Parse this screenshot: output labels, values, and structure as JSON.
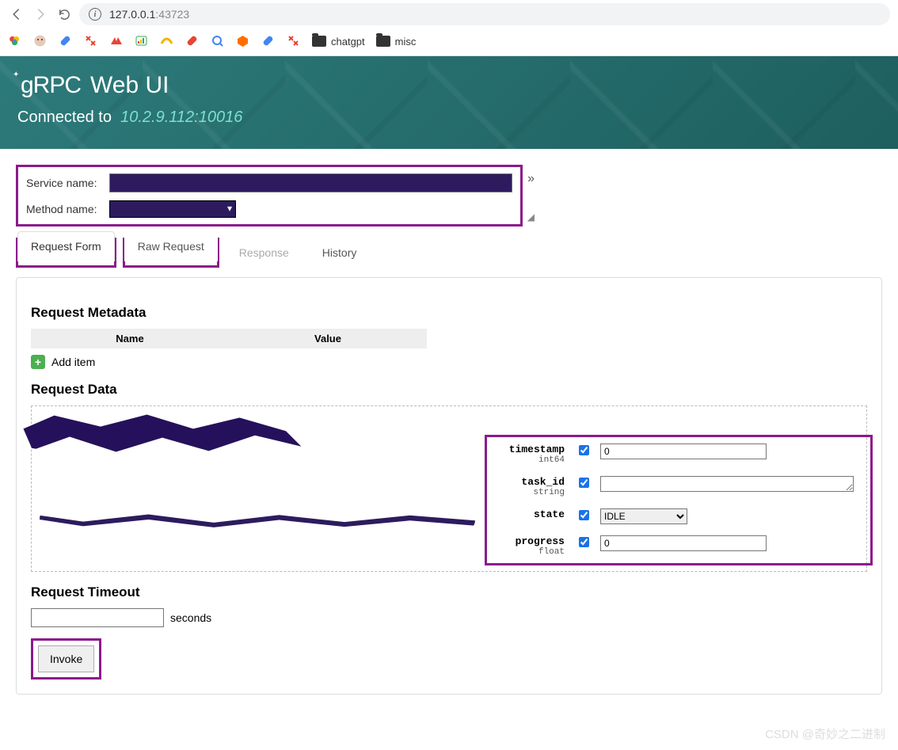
{
  "browser": {
    "url_host": "127.0.0.1",
    "url_port": ":43723",
    "bookmarks": {
      "folder1": "chatgpt",
      "folder2": "misc"
    }
  },
  "header": {
    "logo_text": "gRPC",
    "title": "Web UI",
    "connected_label": "Connected to",
    "address": "10.2.9.112:10016"
  },
  "selector": {
    "service_label": "Service name:",
    "method_label": "Method name:"
  },
  "tabs": {
    "request_form": "Request Form",
    "raw_request": "Raw Request",
    "response": "Response",
    "history": "History"
  },
  "sections": {
    "metadata_title": "Request Metadata",
    "meta_col_name": "Name",
    "meta_col_value": "Value",
    "add_item": "Add item",
    "data_title": "Request Data",
    "timeout_title": "Request Timeout",
    "timeout_unit": "seconds",
    "invoke": "Invoke"
  },
  "fields": [
    {
      "name": "timestamp",
      "type": "int64",
      "checked": true,
      "input": "text",
      "value": "0"
    },
    {
      "name": "task_id",
      "type": "string",
      "checked": true,
      "input": "textarea",
      "value": ""
    },
    {
      "name": "state",
      "type": "",
      "checked": true,
      "input": "select",
      "value": "IDLE"
    },
    {
      "name": "progress",
      "type": "float",
      "checked": true,
      "input": "text",
      "value": "0"
    }
  ],
  "watermark": "CSDN @奇妙之二进制"
}
